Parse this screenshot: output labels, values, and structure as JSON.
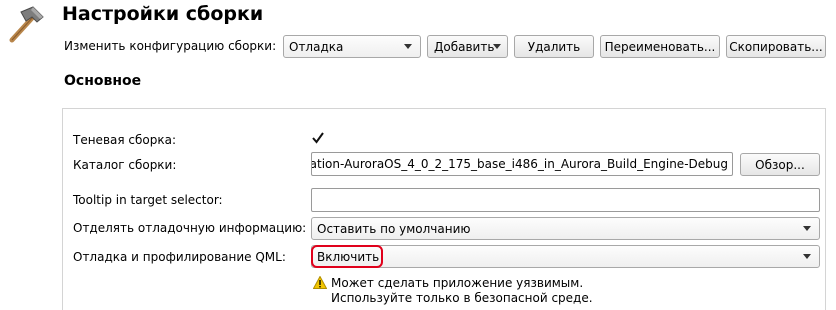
{
  "header": {
    "title": "Настройки сборки",
    "icon": "hammer-icon"
  },
  "config_bar": {
    "label": "Изменить конфигурацию сборки:",
    "selected_config": "Отладка",
    "add_label": "Добавить",
    "delete_label": "Удалить",
    "rename_label": "Переименовать...",
    "copy_label": "Скопировать..."
  },
  "section": {
    "title": "Основное"
  },
  "form": {
    "shadow_build_label": "Теневая сборка:",
    "shadow_build_checked": true,
    "build_dir_label": "Каталог сборки:",
    "build_dir_value": "ation-AuroraOS_4_0_2_175_base_i486_in_Aurora_Build_Engine-Debug",
    "browse_label": "Обзор...",
    "tooltip_label": "Tooltip in target selector:",
    "tooltip_value": "",
    "separate_debug_label": "Отделять отладочную информацию:",
    "separate_debug_value": "Оставить по умолчанию",
    "qml_debug_label": "Отладка и профилирование QML:",
    "qml_debug_value": "Включить",
    "warning_line1": "Может сделать приложение уязвимым.",
    "warning_line2": "Используйте только в безопасной среде."
  },
  "colors": {
    "highlight": "#e0001b",
    "warning": "#f2c500"
  }
}
